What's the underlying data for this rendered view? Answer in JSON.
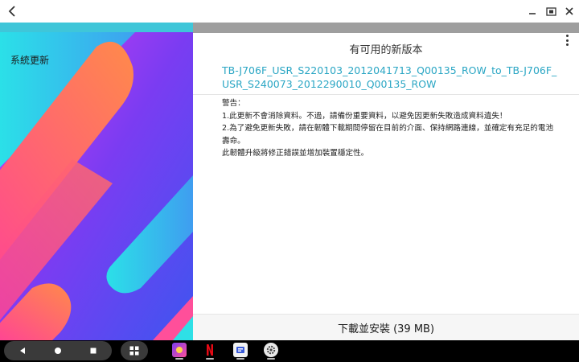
{
  "window": {
    "back_icon": "chevron-left-icon",
    "controls": [
      "minimize-icon",
      "restore-icon",
      "close-icon"
    ]
  },
  "wallpaper": {
    "title": "系統更新",
    "colors": [
      "#3fc6d9",
      "#8a3cf0",
      "#ff6f5e",
      "#ff4f9a",
      "#2ee0e6"
    ]
  },
  "update": {
    "heading": "有可用的新版本",
    "version_name": "TB-J706F_USR_S220103_2012041713_Q00135_ROW_to_TB-J706F_USR_S240073_2012290010_Q00135_ROW",
    "notes": [
      "警告：",
      "1.此更新不會消除資料。不過，請備份重要資料，以避免因更新失敗造成資料遺失！",
      "2.為了避免更新失敗，請在韌體下載期間停留在目前的介面、保持網路連線，並確定有充足的電池壽命。",
      "此韌體升級將修正錯誤並增加裝置穩定性。"
    ],
    "install_label": "下載並安裝 (39 MB)",
    "accent_color": "#2aa6c4"
  },
  "taskbar": {
    "nav": [
      "back-triangle-icon",
      "home-circle-icon",
      "recents-square-icon"
    ],
    "apps": [
      "app-purple",
      "netflix",
      "app-blue",
      "settings-gear"
    ]
  }
}
